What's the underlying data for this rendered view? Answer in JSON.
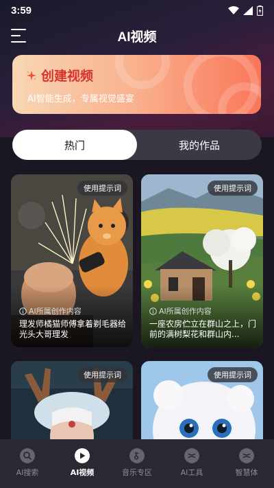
{
  "status_bar": {
    "time": "3:59"
  },
  "header": {
    "title": "AI视频"
  },
  "banner": {
    "title": "创建视频",
    "subtitle": "AI智能生成，专属视觉盛宴"
  },
  "tabs": [
    {
      "label": "热门",
      "active": true
    },
    {
      "label": "我的作品",
      "active": false
    }
  ],
  "cards": [
    {
      "badge": "使用提示词",
      "tag": "AI所属创作内容",
      "desc": "理发师橘猫师傅拿着剃毛器给光头大哥理发"
    },
    {
      "badge": "使用提示词",
      "tag": "AI所属创作内容",
      "desc": "一座农房伫立在群山之上，门前的满树梨花和群山内..."
    },
    {
      "badge": "使用提示词"
    },
    {
      "badge": "使用提示词"
    }
  ],
  "bottom_nav": [
    {
      "label": "AI搜索",
      "icon": "search-icon",
      "active": false
    },
    {
      "label": "AI视频",
      "icon": "play-icon",
      "active": true
    },
    {
      "label": "音乐专区",
      "icon": "music-note-icon",
      "active": false
    },
    {
      "label": "AI工具",
      "icon": "ball-icon",
      "active": false
    },
    {
      "label": "智慧体",
      "icon": "ball-icon",
      "active": false
    }
  ],
  "colors": {
    "accent": "#d6342c",
    "background": "#1a1722",
    "nav_bg": "#2a2832"
  }
}
